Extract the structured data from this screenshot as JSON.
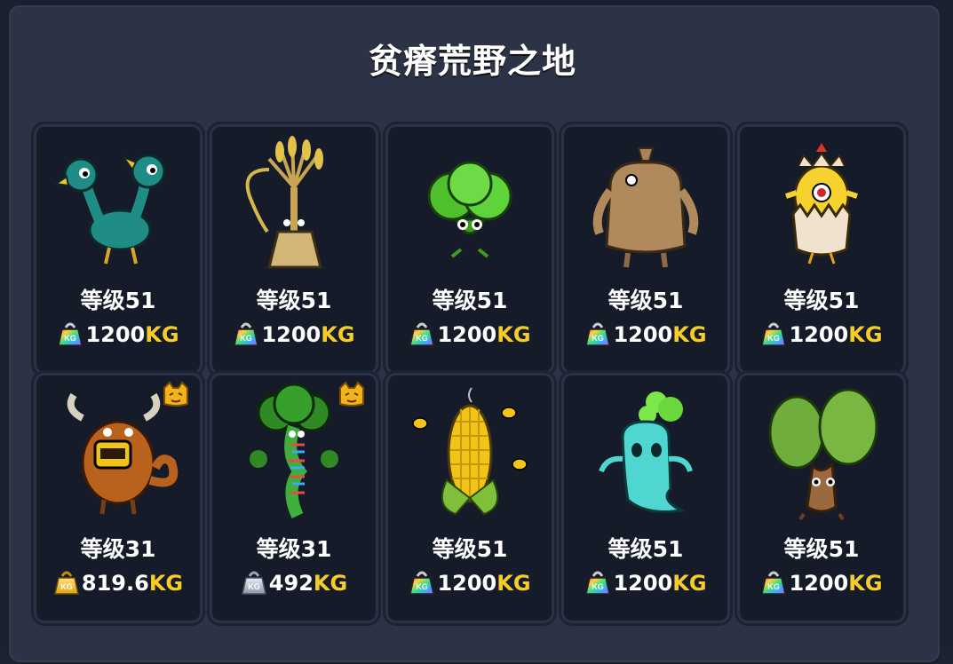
{
  "title": "贫瘠荒野之地",
  "colors": {
    "accent_unit": "#f6cc26",
    "card_bg": "#151b29",
    "panel_bg": "#2c3346"
  },
  "cards": [
    {
      "name": "two-headed-bird",
      "level": "等级51",
      "weight": "1200",
      "unit": "KG",
      "weight_icon": "rainbow-kg-weight-icon",
      "badge": false
    },
    {
      "name": "wheat-creature",
      "level": "等级51",
      "weight": "1200",
      "unit": "KG",
      "weight_icon": "rainbow-kg-weight-icon",
      "badge": false
    },
    {
      "name": "lettuce-creature",
      "level": "等级51",
      "weight": "1200",
      "unit": "KG",
      "weight_icon": "rainbow-kg-weight-icon",
      "badge": false
    },
    {
      "name": "sack-creature",
      "level": "等级51",
      "weight": "1200",
      "unit": "KG",
      "weight_icon": "rainbow-kg-weight-icon",
      "badge": false
    },
    {
      "name": "egg-chick",
      "level": "等级51",
      "weight": "1200",
      "unit": "KG",
      "weight_icon": "rainbow-kg-weight-icon",
      "badge": false
    },
    {
      "name": "yak-creature",
      "level": "等级31",
      "weight": "819.6",
      "unit": "KG",
      "weight_icon": "gold-kg-weight-icon",
      "badge": true
    },
    {
      "name": "broccoli-creature",
      "level": "等级31",
      "weight": "492",
      "unit": "KG",
      "weight_icon": "silver-kg-weight-icon",
      "badge": true
    },
    {
      "name": "corn-creature",
      "level": "等级51",
      "weight": "1200",
      "unit": "KG",
      "weight_icon": "rainbow-kg-weight-icon",
      "badge": false
    },
    {
      "name": "ghost-creature",
      "level": "等级51",
      "weight": "1200",
      "unit": "KG",
      "weight_icon": "rainbow-kg-weight-icon",
      "badge": false
    },
    {
      "name": "cactus-creature",
      "level": "等级51",
      "weight": "1200",
      "unit": "KG",
      "weight_icon": "rainbow-kg-weight-icon",
      "badge": false
    }
  ]
}
